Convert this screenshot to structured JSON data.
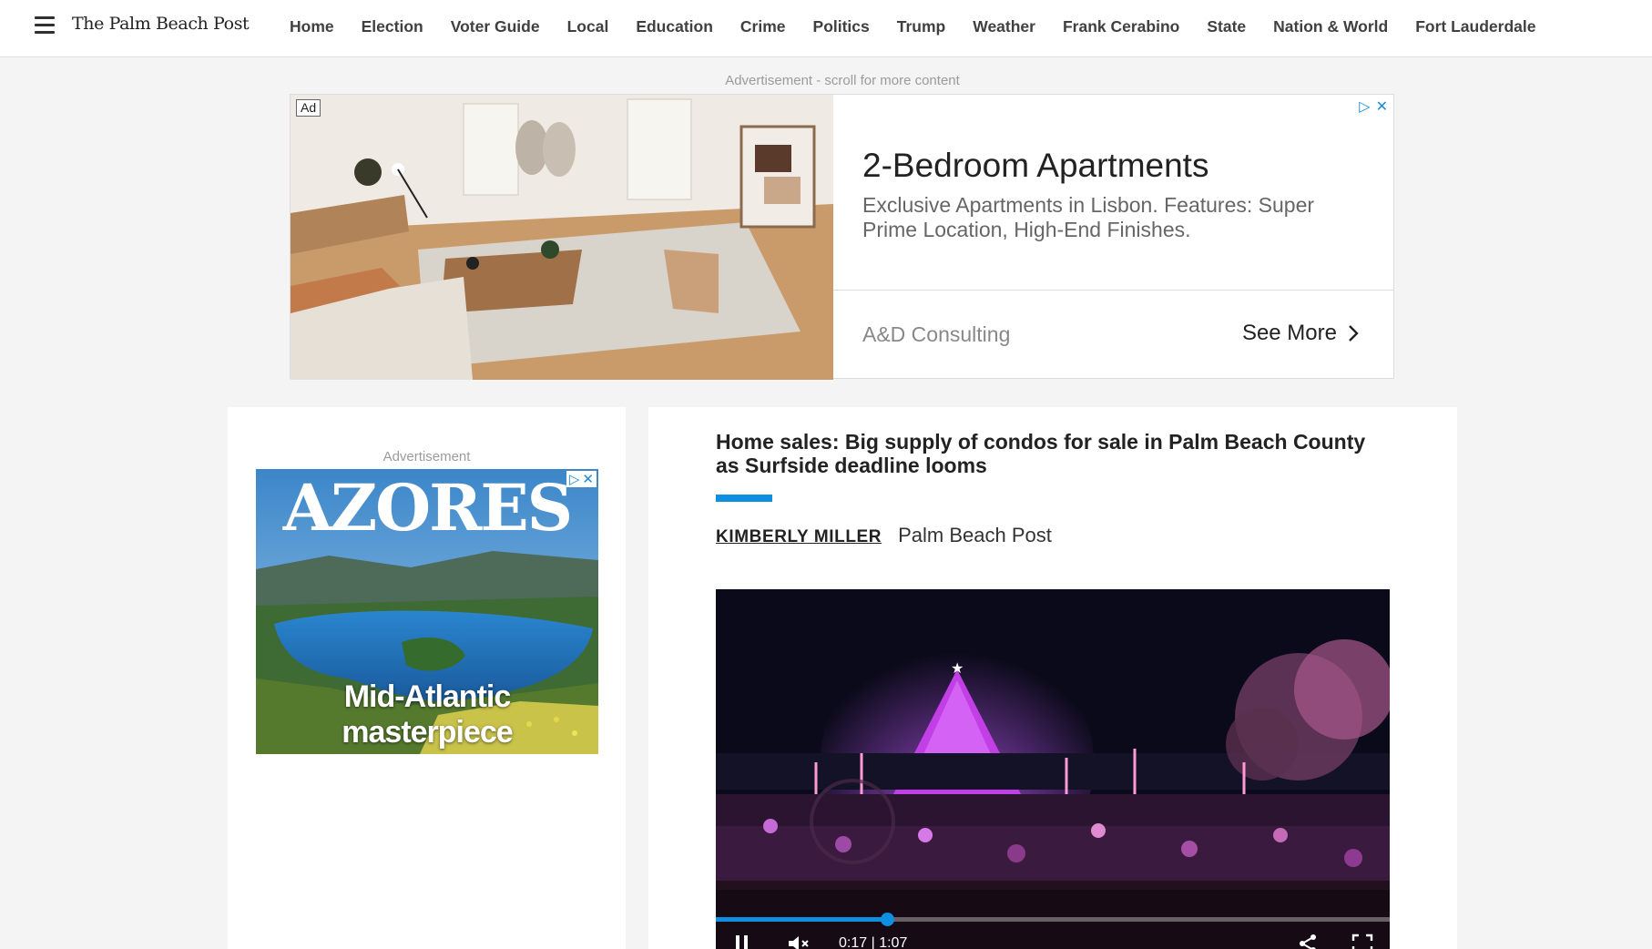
{
  "site": {
    "logo": "The Palm Beach Post",
    "nav": [
      "Home",
      "Election",
      "Voter Guide",
      "Local",
      "Education",
      "Crime",
      "Politics",
      "Trump",
      "Weather",
      "Frank Cerabino",
      "State",
      "Nation & World",
      "Fort Lauderdale"
    ]
  },
  "ad_notice": "Advertisement - scroll for more content",
  "banner_ad": {
    "badge": "Ad",
    "title": "2-Bedroom Apartments",
    "description": "Exclusive Apartments in Lisbon. Features: Super Prime Location, High-End Finishes.",
    "advertiser": "A&D Consulting",
    "cta": "See More"
  },
  "side_ad": {
    "label": "Advertisement",
    "title": "AZORES",
    "tagline": "Mid-Atlantic masterpiece"
  },
  "article": {
    "headline": "Home sales: Big supply of condos for sale in Palm Beach County as Surfside deadline looms",
    "author": "KIMBERLY MILLER",
    "publication": "Palm Beach Post"
  },
  "video": {
    "current_time": "0:17",
    "duration": "1:07",
    "progress": 0.254
  },
  "colors": {
    "accent": "#0f8fe0",
    "adchoices": "#1a8cd8"
  },
  "icons": [
    "hamburger-icon",
    "adchoices-icon",
    "close-icon",
    "chevron-right-icon",
    "pause-icon",
    "mute-icon",
    "share-icon",
    "fullscreen-icon"
  ]
}
